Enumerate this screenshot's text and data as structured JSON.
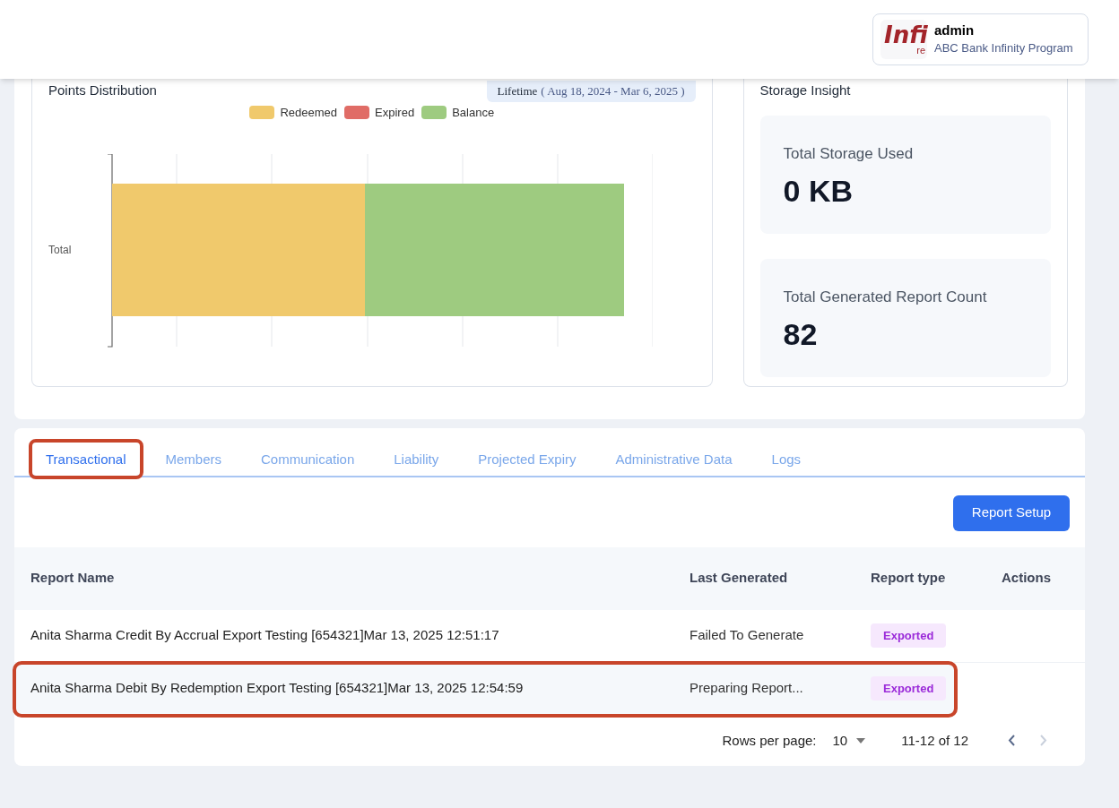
{
  "header": {
    "logo": {
      "main": "Infi",
      "sub": "re"
    },
    "user": "admin",
    "program": "ABC Bank Infinity Program"
  },
  "points_distribution": {
    "title": "Points Distribution",
    "period_label": "Lifetime",
    "period_range": "( Aug 18, 2024 - Mar 6, 2025 )",
    "legend": [
      {
        "label": "Redeemed",
        "color": "#f0c96c"
      },
      {
        "label": "Expired",
        "color": "#e06c66"
      },
      {
        "label": "Balance",
        "color": "#9ecb80"
      }
    ],
    "category": "Total"
  },
  "storage_insight": {
    "title": "Storage Insight",
    "stats": [
      {
        "label": "Total Storage Used",
        "value": "0 KB"
      },
      {
        "label": "Total Generated Report Count",
        "value": "82"
      }
    ]
  },
  "tabs": [
    {
      "label": "Transactional",
      "selected": true,
      "highlighted": true
    },
    {
      "label": "Members",
      "selected": false,
      "highlighted": false
    },
    {
      "label": "Communication",
      "selected": false,
      "highlighted": false
    },
    {
      "label": "Liability",
      "selected": false,
      "highlighted": false
    },
    {
      "label": "Projected Expiry",
      "selected": false,
      "highlighted": false
    },
    {
      "label": "Administrative Data",
      "selected": false,
      "highlighted": false
    },
    {
      "label": "Logs",
      "selected": false,
      "highlighted": false
    }
  ],
  "report_setup_button": "Report Setup",
  "table": {
    "columns": [
      "Report Name",
      "Last Generated",
      "Report type",
      "Actions"
    ],
    "rows": [
      {
        "name": "Anita Sharma Credit By Accrual Export Testing [654321]Mar 13, 2025 12:51:17",
        "last_generated": "Failed To Generate",
        "type": "Exported",
        "highlighted": false
      },
      {
        "name": "Anita Sharma Debit By Redemption Export Testing [654321]Mar 13, 2025 12:54:59",
        "last_generated": "Preparing Report...",
        "type": "Exported",
        "highlighted": true
      }
    ]
  },
  "pagination": {
    "rows_per_page_label": "Rows per page:",
    "rows_per_page": "10",
    "range": "11-12 of 12"
  }
}
